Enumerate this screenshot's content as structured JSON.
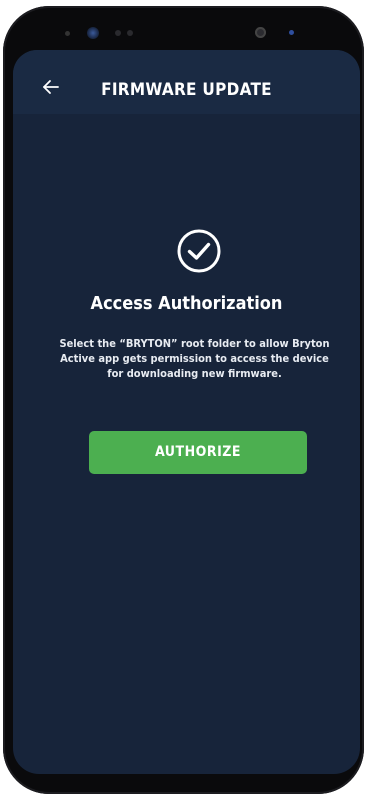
{
  "header": {
    "title": "FIRMWARE UPDATE",
    "back_icon": "arrow-left-icon"
  },
  "main": {
    "icon": "check-circle-icon",
    "heading": "Access Authorization",
    "description": "Select the “BRYTON” root folder to allow Bryton Active app gets permission to access the device for downloading new firmware.",
    "button_label": "AUTHORIZE"
  },
  "colors": {
    "background": "#17243a",
    "header_background": "#1a2a43",
    "accent": "#4caf50",
    "text": "#ffffff"
  }
}
